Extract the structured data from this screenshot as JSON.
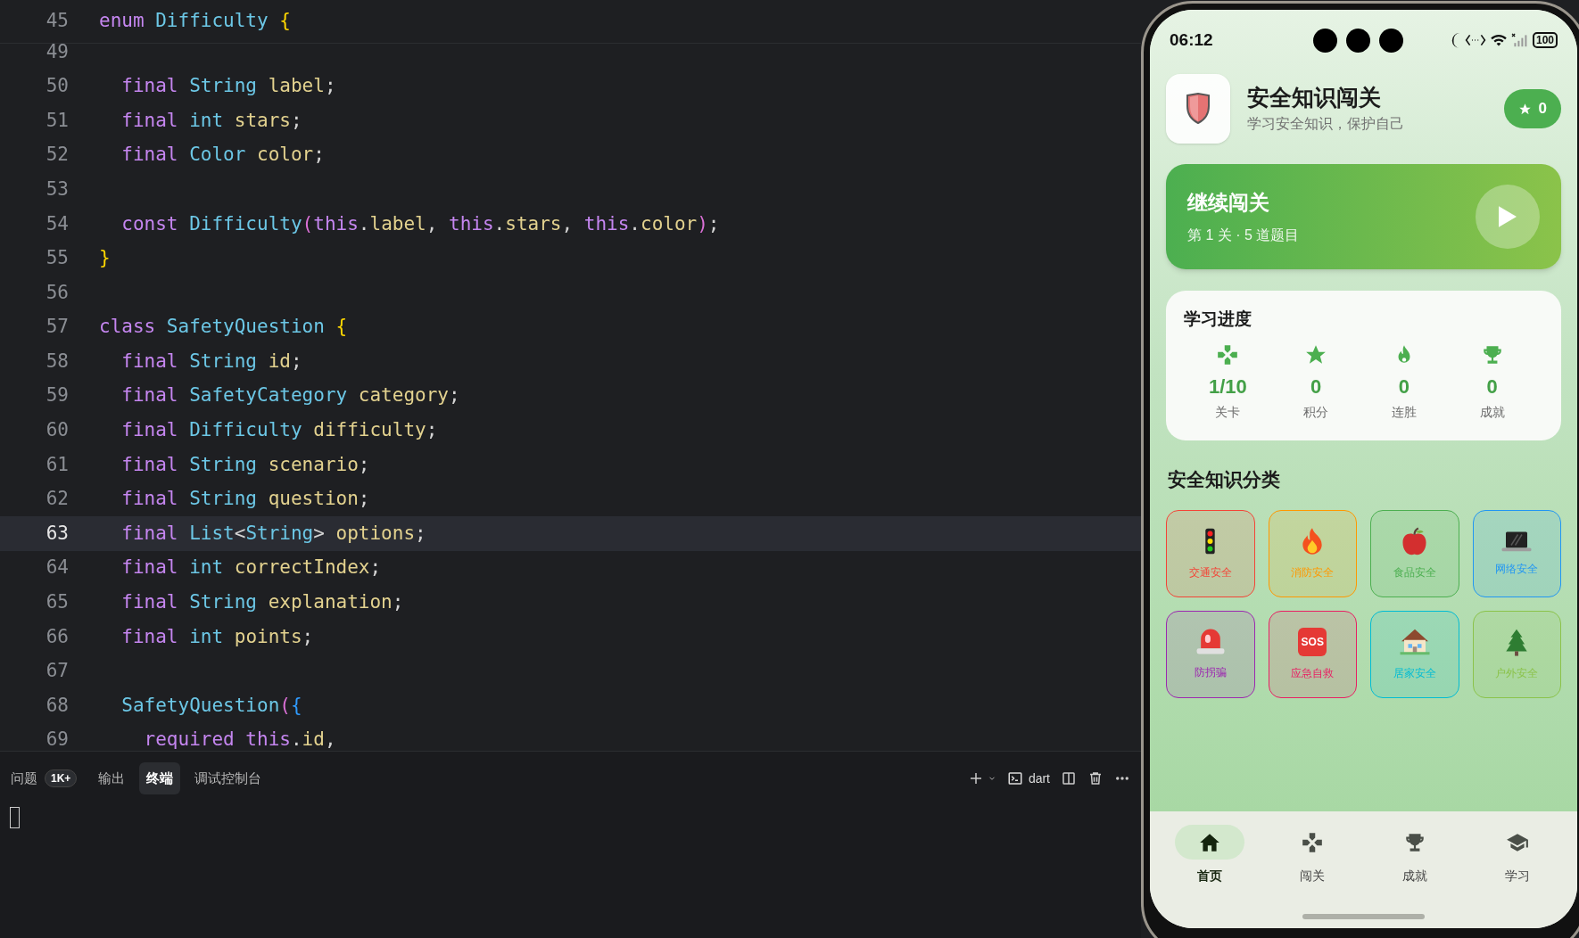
{
  "editor": {
    "sticky_line": {
      "number": "45",
      "tokens": [
        {
          "text": "enum",
          "kind": "kw"
        },
        {
          "text": " Difficulty",
          "kind": "type"
        },
        {
          "text": " {",
          "kind": "b1"
        }
      ]
    },
    "lines": [
      {
        "number": "49",
        "current": false
      },
      {
        "number": "50",
        "current": false,
        "tokens": [
          {
            "text": "  final",
            "kind": "kw"
          },
          {
            "text": " String",
            "kind": "type"
          },
          {
            "text": " label",
            "kind": "field"
          },
          {
            "text": ";",
            "kind": "plain"
          }
        ]
      },
      {
        "number": "51",
        "current": false,
        "tokens": [
          {
            "text": "  final",
            "kind": "kw"
          },
          {
            "text": " int",
            "kind": "type"
          },
          {
            "text": " stars",
            "kind": "field"
          },
          {
            "text": ";",
            "kind": "plain"
          }
        ]
      },
      {
        "number": "52",
        "current": false,
        "tokens": [
          {
            "text": "  final",
            "kind": "kw"
          },
          {
            "text": " Color",
            "kind": "type"
          },
          {
            "text": " color",
            "kind": "field"
          },
          {
            "text": ";",
            "kind": "plain"
          }
        ]
      },
      {
        "number": "53",
        "current": false
      },
      {
        "number": "54",
        "current": false,
        "tokens": [
          {
            "text": "  const",
            "kind": "kw"
          },
          {
            "text": " Difficulty",
            "kind": "type"
          },
          {
            "text": "(",
            "kind": "b2"
          },
          {
            "text": "this",
            "kind": "kw"
          },
          {
            "text": ".",
            "kind": "plain"
          },
          {
            "text": "label",
            "kind": "field"
          },
          {
            "text": ", ",
            "kind": "plain"
          },
          {
            "text": "this",
            "kind": "kw"
          },
          {
            "text": ".",
            "kind": "plain"
          },
          {
            "text": "stars",
            "kind": "field"
          },
          {
            "text": ", ",
            "kind": "plain"
          },
          {
            "text": "this",
            "kind": "kw"
          },
          {
            "text": ".",
            "kind": "plain"
          },
          {
            "text": "color",
            "kind": "field"
          },
          {
            "text": ")",
            "kind": "b2"
          },
          {
            "text": ";",
            "kind": "plain"
          }
        ]
      },
      {
        "number": "55",
        "current": false,
        "tokens": [
          {
            "text": "}",
            "kind": "b1"
          }
        ]
      },
      {
        "number": "56",
        "current": false
      },
      {
        "number": "57",
        "current": false,
        "tokens": [
          {
            "text": "class",
            "kind": "kw"
          },
          {
            "text": " SafetyQuestion",
            "kind": "type"
          },
          {
            "text": " {",
            "kind": "b1"
          }
        ]
      },
      {
        "number": "58",
        "current": false,
        "tokens": [
          {
            "text": "  final",
            "kind": "kw"
          },
          {
            "text": " String",
            "kind": "type"
          },
          {
            "text": " id",
            "kind": "field"
          },
          {
            "text": ";",
            "kind": "plain"
          }
        ]
      },
      {
        "number": "59",
        "current": false,
        "tokens": [
          {
            "text": "  final",
            "kind": "kw"
          },
          {
            "text": " SafetyCategory",
            "kind": "type"
          },
          {
            "text": " category",
            "kind": "field"
          },
          {
            "text": ";",
            "kind": "plain"
          }
        ]
      },
      {
        "number": "60",
        "current": false,
        "tokens": [
          {
            "text": "  final",
            "kind": "kw"
          },
          {
            "text": " Difficulty",
            "kind": "type"
          },
          {
            "text": " difficulty",
            "kind": "field"
          },
          {
            "text": ";",
            "kind": "plain"
          }
        ]
      },
      {
        "number": "61",
        "current": false,
        "tokens": [
          {
            "text": "  final",
            "kind": "kw"
          },
          {
            "text": " String",
            "kind": "type"
          },
          {
            "text": " scenario",
            "kind": "field"
          },
          {
            "text": ";",
            "kind": "plain"
          }
        ]
      },
      {
        "number": "62",
        "current": false,
        "tokens": [
          {
            "text": "  final",
            "kind": "kw"
          },
          {
            "text": " String",
            "kind": "type"
          },
          {
            "text": " question",
            "kind": "field"
          },
          {
            "text": ";",
            "kind": "plain"
          }
        ]
      },
      {
        "number": "63",
        "current": true,
        "tokens": [
          {
            "text": "  final",
            "kind": "kw"
          },
          {
            "text": " List",
            "kind": "type"
          },
          {
            "text": "<",
            "kind": "plain"
          },
          {
            "text": "String",
            "kind": "type"
          },
          {
            "text": "> ",
            "kind": "plain"
          },
          {
            "text": "options",
            "kind": "field"
          },
          {
            "text": ";",
            "kind": "plain"
          }
        ]
      },
      {
        "number": "64",
        "current": false,
        "tokens": [
          {
            "text": "  final",
            "kind": "kw"
          },
          {
            "text": " int",
            "kind": "type"
          },
          {
            "text": " correctIndex",
            "kind": "field"
          },
          {
            "text": ";",
            "kind": "plain"
          }
        ]
      },
      {
        "number": "65",
        "current": false,
        "tokens": [
          {
            "text": "  final",
            "kind": "kw"
          },
          {
            "text": " String",
            "kind": "type"
          },
          {
            "text": " explanation",
            "kind": "field"
          },
          {
            "text": ";",
            "kind": "plain"
          }
        ]
      },
      {
        "number": "66",
        "current": false,
        "tokens": [
          {
            "text": "  final",
            "kind": "kw"
          },
          {
            "text": " int",
            "kind": "type"
          },
          {
            "text": " points",
            "kind": "field"
          },
          {
            "text": ";",
            "kind": "plain"
          }
        ]
      },
      {
        "number": "67",
        "current": false
      },
      {
        "number": "68",
        "current": false,
        "tokens": [
          {
            "text": "  SafetyQuestion",
            "kind": "type"
          },
          {
            "text": "(",
            "kind": "b2"
          },
          {
            "text": "{",
            "kind": "b3"
          }
        ]
      },
      {
        "number": "69",
        "current": false,
        "tokens": [
          {
            "text": "    required",
            "kind": "kw"
          },
          {
            "text": " this",
            "kind": "kw"
          },
          {
            "text": ".",
            "kind": "plain"
          },
          {
            "text": "id",
            "kind": "field"
          },
          {
            "text": ",",
            "kind": "plain"
          }
        ]
      }
    ]
  },
  "panel": {
    "tabs": [
      {
        "label": "问题",
        "badge": "1K+",
        "selected": false
      },
      {
        "label": "输出",
        "selected": false
      },
      {
        "label": "终端",
        "selected": true
      },
      {
        "label": "调试控制台",
        "selected": false
      }
    ],
    "terminal_name": "dart"
  },
  "phone": {
    "status_bar": {
      "time": "06:12",
      "battery": "100"
    },
    "app_title": "安全知识闯关",
    "app_subtitle": "学习安全知识，保护自己",
    "score_badge": "0",
    "continue_card": {
      "title": "继续闯关",
      "subtitle": "第 1 关 · 5 道题目"
    },
    "progress": {
      "title": "学习进度",
      "stats": [
        {
          "kind": "gamepad",
          "value": "1/10",
          "label": "关卡"
        },
        {
          "kind": "star",
          "value": "0",
          "label": "积分"
        },
        {
          "kind": "fire",
          "value": "0",
          "label": "连胜"
        },
        {
          "kind": "trophy",
          "value": "0",
          "label": "成就"
        }
      ]
    },
    "categories_title": "安全知识分类",
    "categories": [
      {
        "kind": "traffic",
        "label": "交通安全",
        "color": "#f44336"
      },
      {
        "kind": "fire",
        "label": "消防安全",
        "color": "#ff9800"
      },
      {
        "kind": "apple",
        "label": "食品安全",
        "color": "#4caf50"
      },
      {
        "kind": "laptop",
        "label": "网络安全",
        "color": "#2196f3"
      },
      {
        "kind": "siren",
        "label": "防拐骗",
        "color": "#9c27b0"
      },
      {
        "kind": "sos",
        "label": "应急自救",
        "color": "#e91e63",
        "icon_text": "SOS"
      },
      {
        "kind": "house",
        "label": "居家安全",
        "color": "#00bcd4"
      },
      {
        "kind": "tree",
        "label": "户外安全",
        "color": "#8bc34a"
      }
    ],
    "nav": [
      {
        "kind": "home",
        "label": "首页",
        "selected": true
      },
      {
        "kind": "gamepad",
        "label": "闯关",
        "selected": false
      },
      {
        "kind": "trophy",
        "label": "成就",
        "selected": false
      },
      {
        "kind": "school",
        "label": "学习",
        "selected": false
      }
    ]
  }
}
